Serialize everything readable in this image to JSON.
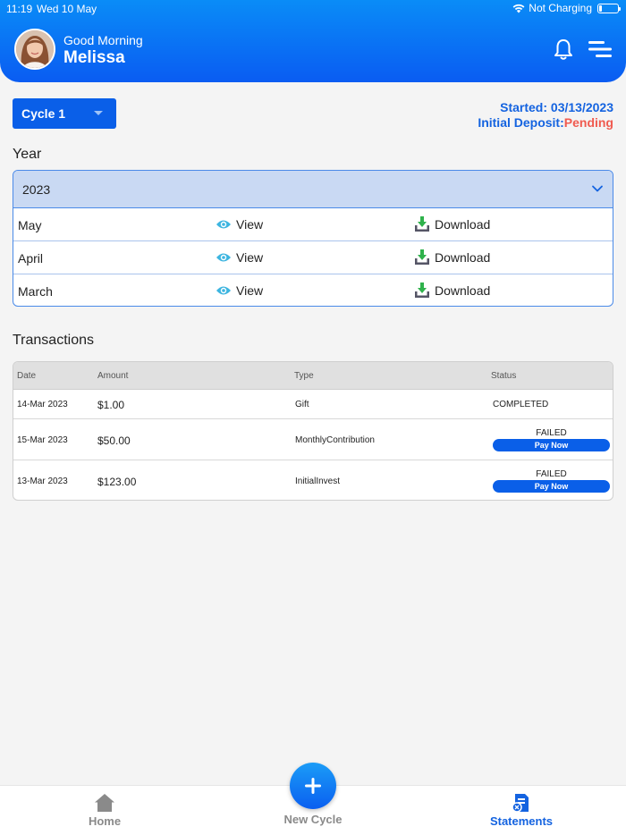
{
  "status_bar": {
    "time": "11:19",
    "date": "Wed 10 May",
    "network": "Not Charging"
  },
  "header": {
    "greeting": "Good Morning",
    "user_name": "Melissa"
  },
  "cycle": {
    "selected": "Cycle 1",
    "started_label": "Started:",
    "started_value": "03/13/2023",
    "deposit_label": "Initial Deposit:",
    "deposit_value": "Pending"
  },
  "year_section": {
    "title": "Year",
    "selected_year": "2023",
    "months": [
      {
        "name": "May",
        "view": "View",
        "download": "Download"
      },
      {
        "name": "April",
        "view": "View",
        "download": "Download"
      },
      {
        "name": "March",
        "view": "View",
        "download": "Download"
      }
    ]
  },
  "transactions": {
    "title": "Transactions",
    "columns": [
      "Date",
      "Amount",
      "Type",
      "Status"
    ],
    "rows": [
      {
        "date": "14-Mar 2023",
        "amount": "$1.00",
        "type": "Gift",
        "status": "COMPLETED",
        "action": ""
      },
      {
        "date": "15-Mar 2023",
        "amount": "$50.00",
        "type": "MonthlyContribution",
        "status": "FAILED",
        "action": "Pay Now"
      },
      {
        "date": "13-Mar 2023",
        "amount": "$123.00",
        "type": "InitialInvest",
        "status": "FAILED",
        "action": "Pay Now"
      }
    ]
  },
  "tabbar": {
    "home": "Home",
    "new_cycle": "New Cycle",
    "statements": "Statements"
  },
  "colors": {
    "primary": "#0a5fe8",
    "pending": "#f05a4f",
    "accent_blue": "#1463e0",
    "view_icon": "#3db5e0",
    "download_icon": "#2fb24c"
  },
  "icons": [
    "bell-icon",
    "menu-icon",
    "chevron-down-icon",
    "eye-icon",
    "download-icon",
    "home-icon",
    "plus-icon",
    "statements-icon",
    "wifi-icon",
    "battery-icon"
  ]
}
